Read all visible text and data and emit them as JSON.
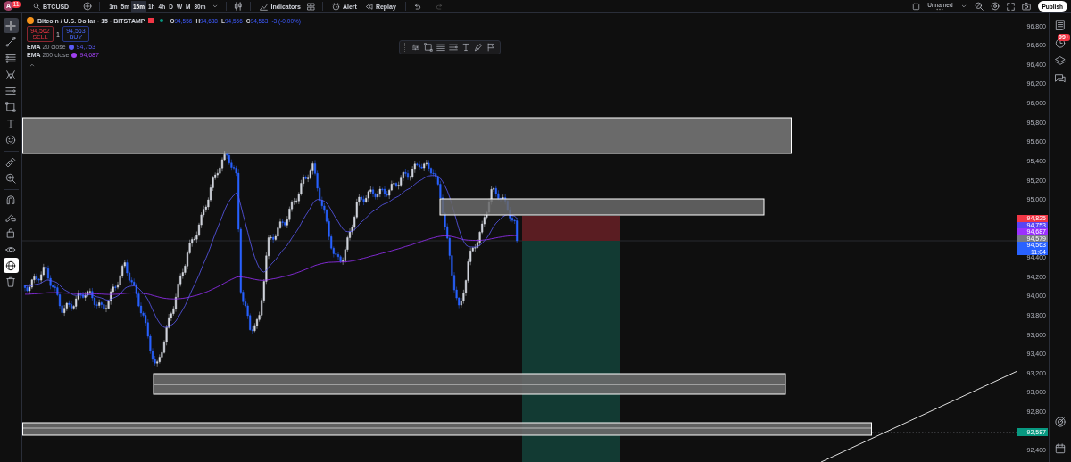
{
  "topbar": {
    "avatar_letter": "A",
    "avatar_badge": "11",
    "symbol": "BTCUSD",
    "intervals": [
      {
        "label": "1m",
        "selected": false
      },
      {
        "label": "5m",
        "selected": false
      },
      {
        "label": "15m",
        "selected": true
      },
      {
        "label": "1h",
        "selected": false
      },
      {
        "label": "4h",
        "selected": false
      },
      {
        "label": "D",
        "selected": false
      },
      {
        "label": "W",
        "selected": false
      },
      {
        "label": "M",
        "selected": false
      },
      {
        "label": "30m",
        "selected": false
      }
    ],
    "indicators_label": "Indicators",
    "alert_label": "Alert",
    "replay_label": "Replay",
    "layout_name": "Unnamed",
    "publish_label": "Publish"
  },
  "left_toolbar": {
    "groups": [
      {
        "tools": [
          {
            "kind": "crosshair",
            "selected": true
          },
          {
            "kind": "trendline",
            "selected": false
          },
          {
            "kind": "fib",
            "selected": false
          },
          {
            "kind": "pattern",
            "selected": false
          },
          {
            "kind": "forecast",
            "selected": false
          },
          {
            "kind": "rectangle",
            "selected": false
          },
          {
            "kind": "text",
            "selected": false
          },
          {
            "kind": "emoji",
            "selected": false
          }
        ]
      },
      {
        "tools": [
          {
            "kind": "ruler",
            "selected": false
          },
          {
            "kind": "zoom",
            "selected": false
          }
        ]
      },
      {
        "tools": [
          {
            "kind": "magnet",
            "selected": false,
            "on": false
          },
          {
            "kind": "pencil-lock",
            "selected": false,
            "on": false
          },
          {
            "kind": "lock",
            "selected": false,
            "on": false
          },
          {
            "kind": "eye",
            "selected": false,
            "on": false
          },
          {
            "kind": "globe",
            "selected": false,
            "on": true
          },
          {
            "kind": "trash",
            "selected": false
          }
        ]
      }
    ]
  },
  "legend": {
    "title": "Bitcoin / U.S. Dollar · 15 · BITSTAMP",
    "ohlc": [
      {
        "label": "O",
        "value": "94,556"
      },
      {
        "label": "H",
        "value": "94,638"
      },
      {
        "label": "L",
        "value": "94,556"
      },
      {
        "label": "C",
        "value": "94,563"
      }
    ],
    "change": "-3 (-0.00%)",
    "sell": {
      "price": "94,562",
      "label": "SELL"
    },
    "quantity": "1",
    "buy": {
      "price": "94,563",
      "label": "BUY"
    },
    "indicators": [
      {
        "name": "EMA",
        "params": "20 close",
        "value": "94,753",
        "color": "#5b5bf5"
      },
      {
        "name": "EMA",
        "params": "200 close",
        "value": "94,687",
        "color": "#a040f0"
      }
    ]
  },
  "price_axis": {
    "ticks": [
      "96,800",
      "96,600",
      "96,400",
      "96,200",
      "96,000",
      "95,800",
      "95,600",
      "95,400",
      "95,200",
      "95,000",
      "94,400",
      "94,200",
      "94,000",
      "93,800",
      "93,600",
      "93,400",
      "93,200",
      "93,000",
      "92,800",
      "92,400"
    ],
    "badges": [
      {
        "value": "94,825",
        "color": "#f23645"
      },
      {
        "value": "94,753",
        "color": "#5b43f5"
      },
      {
        "value": "94,687",
        "color": "#9b30ff"
      },
      {
        "value": "94,579",
        "color": "#787b86"
      },
      {
        "value": "94,563",
        "time": "11:04",
        "color": "#2962ff"
      }
    ],
    "line_badge": {
      "value": "92,587",
      "color": "#089981"
    }
  },
  "right_sidebar": {
    "alerts_badge": "99+"
  }
}
